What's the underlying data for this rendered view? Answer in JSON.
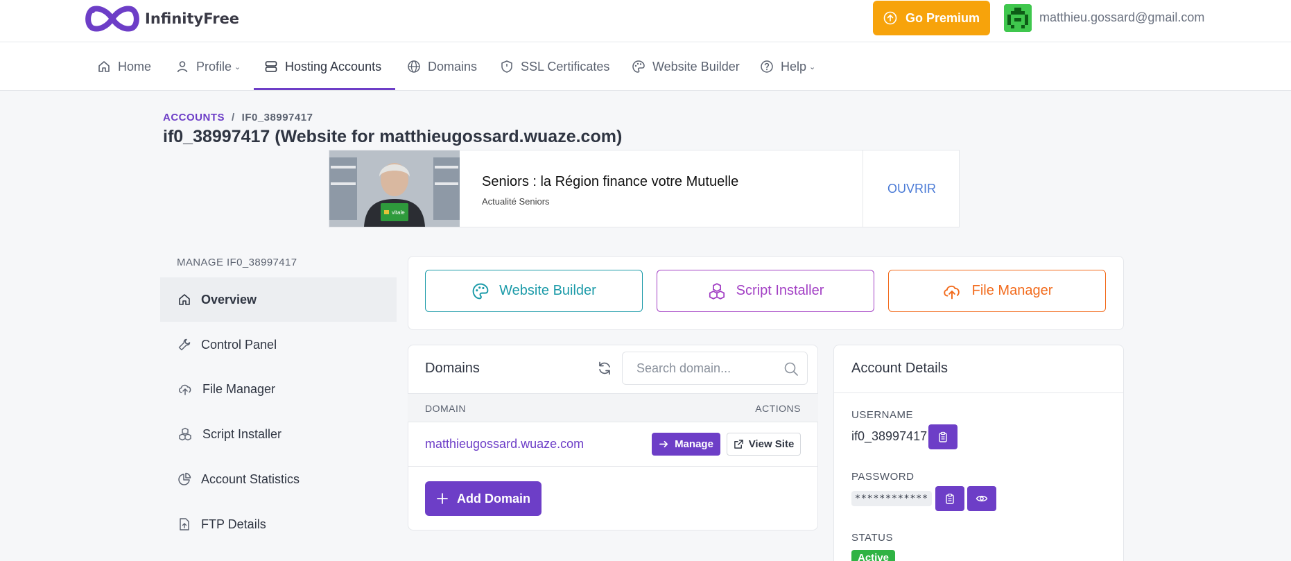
{
  "brand": {
    "name": "InfinityFree"
  },
  "header": {
    "premium_label": "Go Premium",
    "user_email": "matthieu.gossard@gmail.com"
  },
  "nav": {
    "home": "Home",
    "profile": "Profile",
    "hosting_accounts": "Hosting Accounts",
    "domains": "Domains",
    "ssl": "SSL Certificates",
    "website_builder": "Website Builder",
    "help": "Help",
    "active": "Hosting Accounts"
  },
  "breadcrumb": {
    "root": "ACCOUNTS",
    "separator": "/",
    "current": "IF0_38997417"
  },
  "page": {
    "title": "if0_38997417 (Website for matthieugossard.wuaze.com)"
  },
  "ad": {
    "headline": "Seniors : la Région finance votre Mutuelle",
    "source": "Actualité Seniors",
    "cta": "OUVRIR",
    "card_text": "vitale"
  },
  "sidebar": {
    "heading": "MANAGE IF0_38997417",
    "items": [
      {
        "label": "Overview",
        "icon": "home-icon",
        "active": true
      },
      {
        "label": "Control Panel",
        "icon": "wrench-icon"
      },
      {
        "label": "File Manager",
        "icon": "cloud-upload-icon"
      },
      {
        "label": "Script Installer",
        "icon": "cubes-icon"
      },
      {
        "label": "Account Statistics",
        "icon": "pie-chart-icon"
      },
      {
        "label": "FTP Details",
        "icon": "file-upload-icon"
      }
    ]
  },
  "tools": {
    "website_builder": {
      "label": "Website Builder",
      "color": "#1a9aa8"
    },
    "script_installer": {
      "label": "Script Installer",
      "color": "#a23fc4"
    },
    "file_manager": {
      "label": "File Manager",
      "color": "#f26a1b"
    }
  },
  "domains_card": {
    "title": "Domains",
    "search_placeholder": "Search domain...",
    "columns": {
      "domain": "DOMAIN",
      "actions": "ACTIONS"
    },
    "rows": [
      {
        "domain": "matthieugossard.wuaze.com",
        "manage_label": "Manage",
        "view_label": "View Site"
      }
    ],
    "add_label": "Add Domain"
  },
  "account_details": {
    "title": "Account Details",
    "username_label": "USERNAME",
    "username": "if0_38997417",
    "password_label": "PASSWORD",
    "password_mask": "************",
    "status_label": "STATUS",
    "status": "Active"
  },
  "colors": {
    "accent": "#6d3ec7",
    "premium": "#f7a30b",
    "active_status": "#2fb344"
  }
}
